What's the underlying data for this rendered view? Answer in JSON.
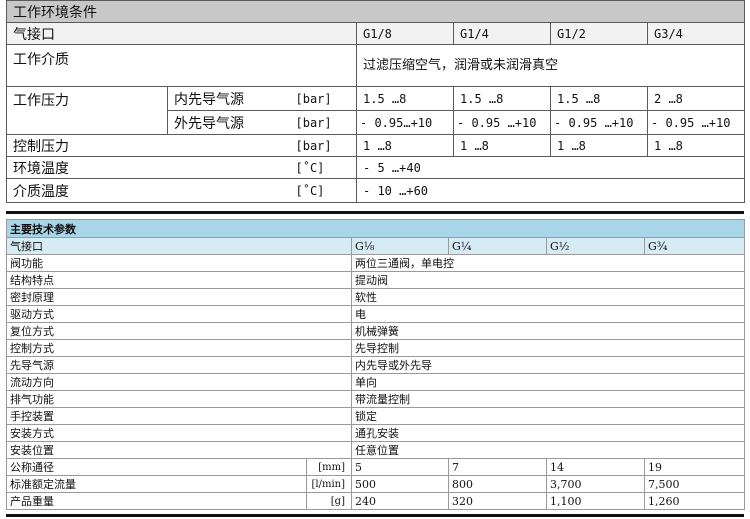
{
  "env": {
    "title": "工作环境条件",
    "port_label": "气接口",
    "ports": [
      "G1/8",
      "G1/4",
      "G1/2",
      "G3/4"
    ],
    "medium_label": "工作介质",
    "medium_value": "过滤压缩空气，润滑或未润滑真空",
    "pressure_label": "工作压力",
    "internal_pilot": "内先导气源",
    "external_pilot": "外先导气源",
    "unit_bar": "[bar]",
    "unit_c": "[˚C]",
    "internal_values": [
      "1.5 …8",
      "1.5 …8",
      "1.5 …8",
      "2 …8"
    ],
    "external_values": [
      "- 0.95…+10",
      "- 0.95 …+10",
      "- 0.95 …+10",
      "- 0.95 …+10"
    ],
    "control_label": "控制压力",
    "control_values": [
      "1 …8",
      "1 …8",
      "1 …8",
      "1 …8"
    ],
    "ambient_label": "环境温度",
    "ambient_value": "- 5 …+40",
    "medium_temp_label": "介质温度",
    "medium_temp_value": "- 10 …+60"
  },
  "specs": {
    "title": "主要技术参数",
    "port_label": "气接口",
    "ports": [
      "G⅛",
      "G¼",
      "G½",
      "G¾"
    ],
    "rows": [
      {
        "label": "阀功能",
        "value": "两位三通阀，单电控"
      },
      {
        "label": "结构特点",
        "value": "提动阀"
      },
      {
        "label": "密封原理",
        "value": "软性"
      },
      {
        "label": "驱动方式",
        "value": "电"
      },
      {
        "label": "复位方式",
        "value": "机械弹簧"
      },
      {
        "label": "控制方式",
        "value": "先导控制"
      },
      {
        "label": "先导气源",
        "value": "内先导或外先导"
      },
      {
        "label": "流动方向",
        "value": "单向"
      },
      {
        "label": "排气功能",
        "value": "带流量控制"
      },
      {
        "label": "手控装置",
        "value": "锁定"
      },
      {
        "label": "安装方式",
        "value": "通孔安装"
      },
      {
        "label": "安装位置",
        "value": "任意位置"
      }
    ],
    "unit_rows": [
      {
        "label": "公称通径",
        "unit": "[mm]",
        "values": [
          "5",
          "7",
          "14",
          "19"
        ]
      },
      {
        "label": "标准额定流量",
        "unit": "[l/min]",
        "values": [
          "500",
          "800",
          "3,700",
          "7,500"
        ]
      },
      {
        "label": "产品重量",
        "unit": "[g]",
        "values": [
          "240",
          "320",
          "1,100",
          "1,260"
        ]
      }
    ]
  }
}
